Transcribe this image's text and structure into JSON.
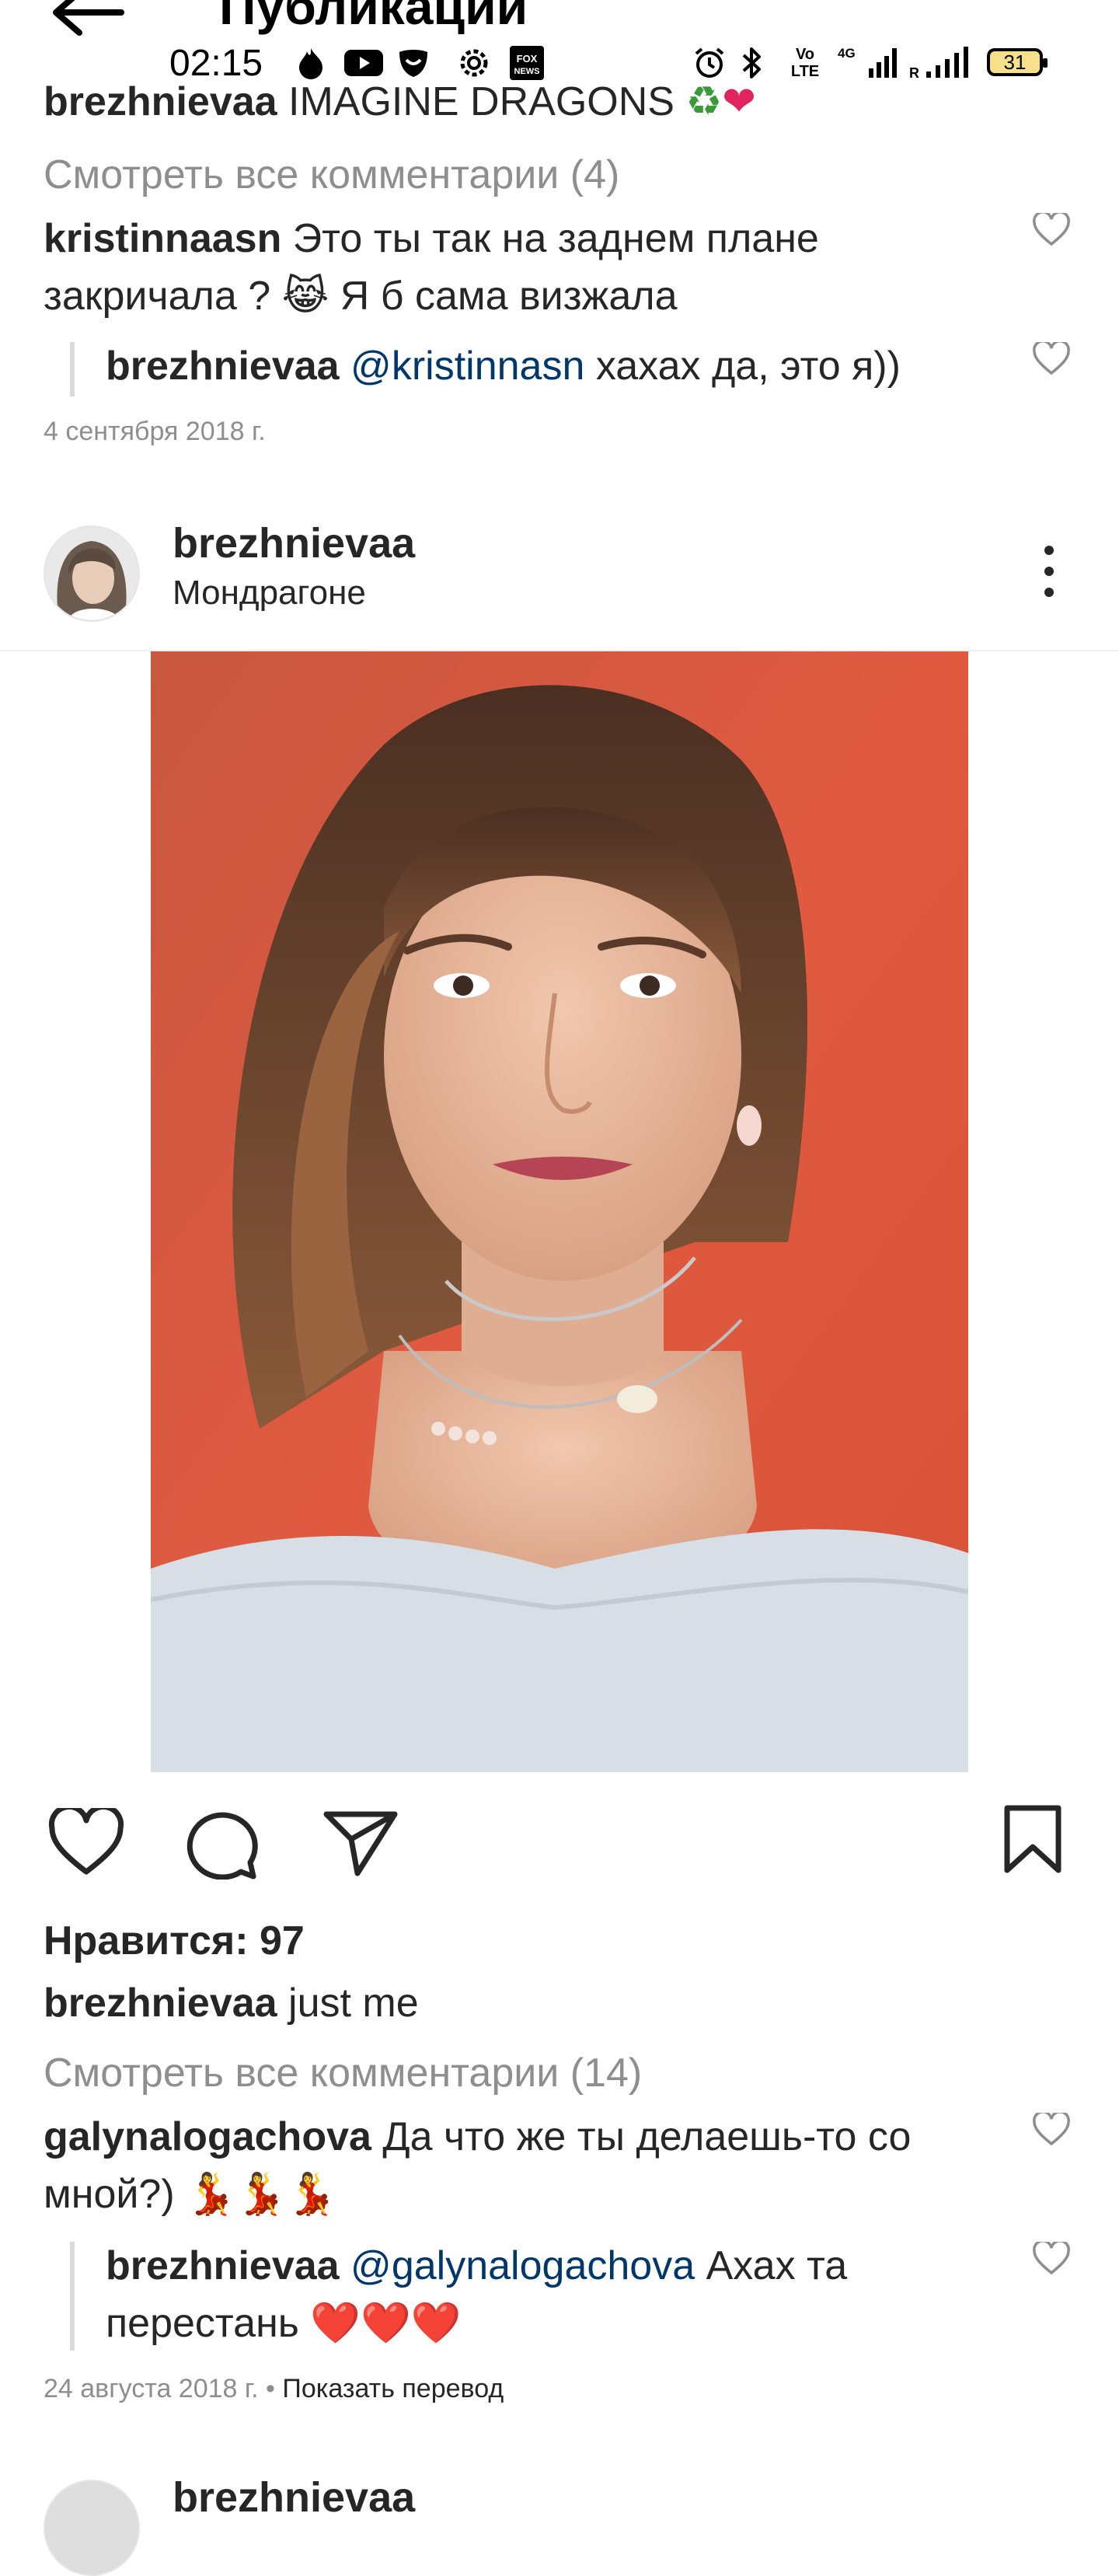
{
  "header": {
    "title": "Публикации"
  },
  "status_bar": {
    "time": "02:15",
    "network": "4G",
    "volte": "Vo LTE",
    "battery": "31",
    "icons": [
      "flame-icon",
      "youtube-icon",
      "shield-icon",
      "settings-icon",
      "fox-news-icon",
      "alarm-icon",
      "bluetooth-icon",
      "volte-icon",
      "signal-icon",
      "battery-icon"
    ],
    "fox_label": "FOX NEWS"
  },
  "prev_post": {
    "caption_user": "brezhnievaa",
    "caption_text": "IMAGINE DRAGONS",
    "view_comments": "Смотреть все комментарии (4)",
    "comments": [
      {
        "user": "kristinnaasn",
        "text": "Это ты так на заднем плане закричала ? 😹 Я б сама визжала"
      }
    ],
    "reply": {
      "user": "brezhnievaa",
      "mention": "@kristinnasn",
      "text": "хахах да, это я))"
    },
    "date": "4 сентября 2018 г."
  },
  "post": {
    "username": "brezhnievaa",
    "location": "Мондрагоне",
    "likes": "Нравится: 97",
    "caption_user": "brezhnievaa",
    "caption_text": "just me",
    "view_comments": "Смотреть все комментарии (14)",
    "comment": {
      "user": "galynalogachova",
      "text": "Да что же ты делаешь-то со мной?) 💃💃💃"
    },
    "reply": {
      "user": "brezhnievaa",
      "mention": "@galynalogachova",
      "text": "Ахах та перестань ❤️❤️❤️"
    },
    "date": "24 августа 2018 г.",
    "separator": "•",
    "translate": "Показать перевод"
  },
  "next_post": {
    "username": "brezhnievaa"
  },
  "colors": {
    "text": "#262626",
    "muted": "#8e8e8e",
    "link": "#00376b",
    "photo_bg": "#e4573f"
  }
}
